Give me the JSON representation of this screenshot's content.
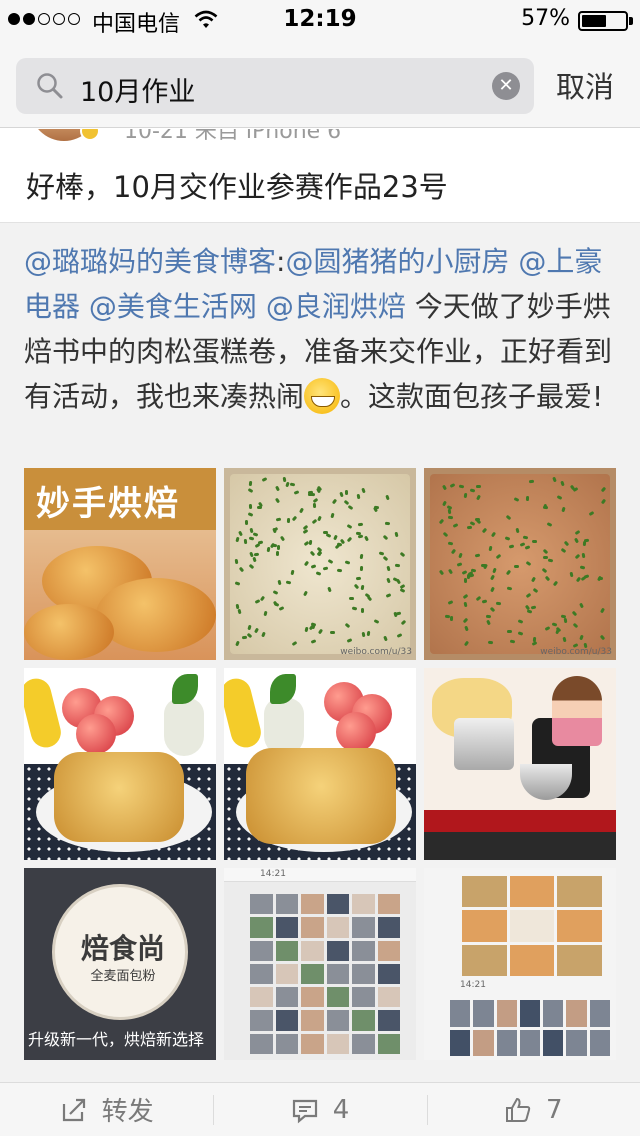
{
  "status_bar": {
    "carrier": "中国电信",
    "time": "12:19",
    "battery_percent": "57%",
    "battery_level": 0.57,
    "signal_bars_filled": 2,
    "signal_bars_total": 5
  },
  "search": {
    "query": "10月作业",
    "cancel_label": "取消"
  },
  "comment": {
    "meta_partial": "10-21 来自 iPhone 6",
    "text": "好棒，10月交作业参赛作品23号"
  },
  "retweet": {
    "segments": [
      {
        "text": "@璐璐妈的美食博客",
        "mention": true
      },
      {
        "text": ":",
        "mention": false
      },
      {
        "text": "@圆猪猪的小厨房",
        "mention": true
      },
      {
        "text": " ",
        "mention": false
      },
      {
        "text": "@上豪电器",
        "mention": true
      },
      {
        "text": " ",
        "mention": false
      },
      {
        "text": "@美食生活网",
        "mention": true
      },
      {
        "text": " ",
        "mention": false
      },
      {
        "text": "@良润烘焙",
        "mention": true
      },
      {
        "text": " 今天做了妙手烘焙书中的肉松蛋糕卷，准备来交作业，正好看到有活动，我也来凑热闹",
        "mention": false
      }
    ],
    "emoji": "grin-emoji",
    "tail": "。这款面包孩子最爱!"
  },
  "images": {
    "book_title": "妙手烘焙",
    "logo_main": "焙食尚",
    "logo_sub": "全麦面包粉",
    "caption": "升级新一代，烘焙新选择",
    "wm_2": "weibo.com/u/33",
    "wm_3": "weibo.com/u/33",
    "shot_time": "14:21"
  },
  "actions": {
    "repost_label": "转发",
    "comment_count": "4",
    "like_count": "7"
  },
  "colors": {
    "mention": "#4f78b0",
    "background": "#f2f2f2"
  }
}
